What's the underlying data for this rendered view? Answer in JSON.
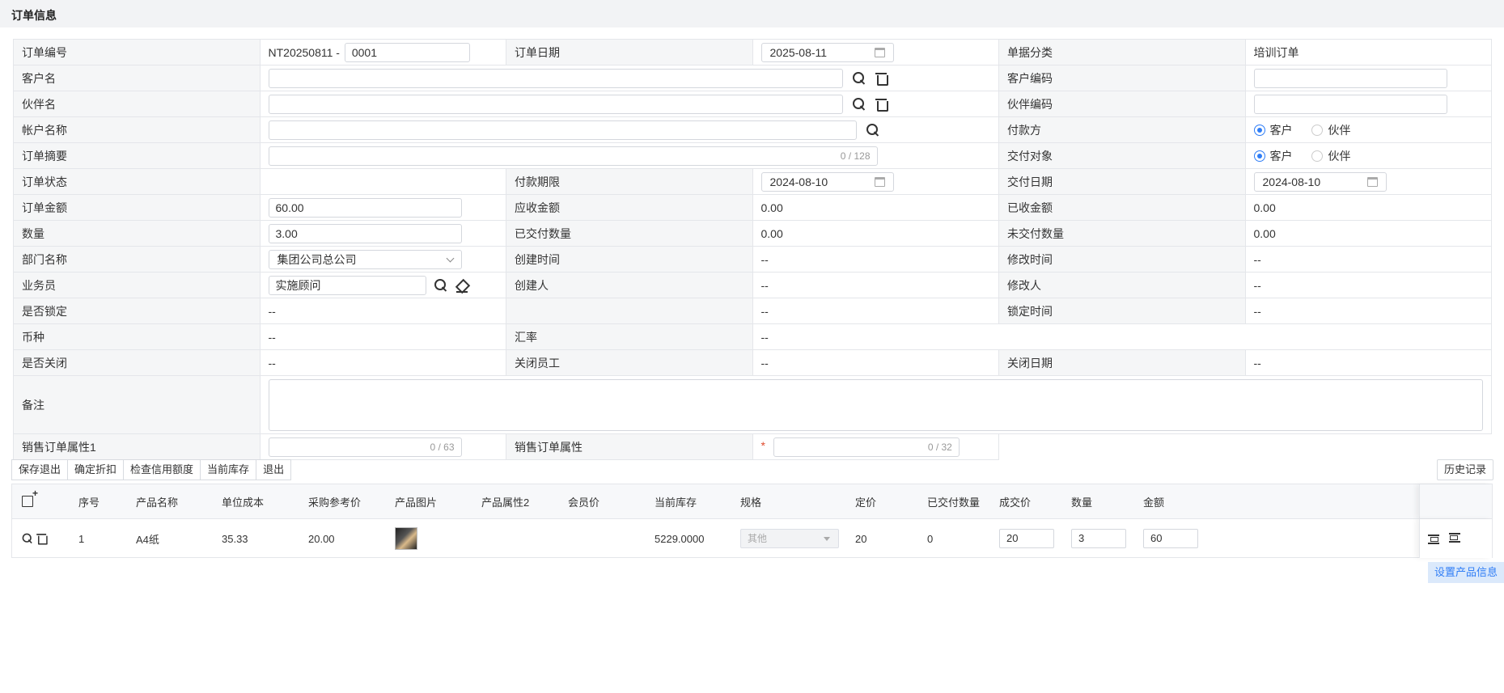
{
  "header": {
    "title": "订单信息"
  },
  "form": {
    "order_no": {
      "label": "订单编号",
      "prefix": "NT20250811 -",
      "value": "0001"
    },
    "order_date": {
      "label": "订单日期",
      "value": "2025-08-11"
    },
    "doc_category": {
      "label": "单据分类",
      "value": "培训订单"
    },
    "customer_name": {
      "label": "客户名",
      "value": ""
    },
    "customer_code": {
      "label": "客户编码",
      "value": ""
    },
    "partner_name": {
      "label": "伙伴名",
      "value": ""
    },
    "partner_code": {
      "label": "伙伴编码",
      "value": ""
    },
    "account_name": {
      "label": "帐户名称",
      "value": ""
    },
    "payer": {
      "label": "付款方",
      "options": [
        "客户",
        "伙伴"
      ],
      "selected": "客户"
    },
    "summary": {
      "label": "订单摘要",
      "value": "",
      "counter": "0 / 128"
    },
    "delivery_target": {
      "label": "交付对象",
      "options": [
        "客户",
        "伙伴"
      ],
      "selected": "客户"
    },
    "order_status": {
      "label": "订单状态",
      "value": ""
    },
    "payment_deadline": {
      "label": "付款期限",
      "value": "2024-08-10"
    },
    "delivery_date": {
      "label": "交付日期",
      "value": "2024-08-10"
    },
    "order_amount": {
      "label": "订单金额",
      "value": "60.00"
    },
    "receivable": {
      "label": "应收金额",
      "value": "0.00"
    },
    "received": {
      "label": "已收金额",
      "value": "0.00"
    },
    "quantity": {
      "label": "数量",
      "value": "3.00"
    },
    "delivered_qty": {
      "label": "已交付数量",
      "value": "0.00"
    },
    "undelivered_qty": {
      "label": "未交付数量",
      "value": "0.00"
    },
    "department": {
      "label": "部门名称",
      "value": "集团公司总公司"
    },
    "created_time": {
      "label": "创建时间",
      "value": "--"
    },
    "modified_time": {
      "label": "修改时间",
      "value": "--"
    },
    "salesperson": {
      "label": "业务员",
      "value": "实施顾问"
    },
    "creator": {
      "label": "创建人",
      "value": "--"
    },
    "modifier": {
      "label": "修改人",
      "value": "--"
    },
    "is_locked": {
      "label": "是否锁定",
      "value": "--"
    },
    "locker": {
      "label": "",
      "value": "--"
    },
    "lock_time": {
      "label": "锁定时间",
      "value": "--"
    },
    "currency": {
      "label": "币种",
      "value": "--"
    },
    "exchange_rate": {
      "label": "汇率",
      "value": "--"
    },
    "is_closed": {
      "label": "是否关闭",
      "value": "--"
    },
    "close_employee": {
      "label": "关闭员工",
      "value": "--"
    },
    "close_date": {
      "label": "关闭日期",
      "value": "--"
    },
    "remark": {
      "label": "备注",
      "value": ""
    },
    "attr1": {
      "label": "销售订单属性1",
      "value": "",
      "counter": "0 / 63"
    },
    "attr": {
      "label": "销售订单属性",
      "required_mark": "*",
      "value": "",
      "counter": "0 / 32"
    }
  },
  "toolbar": {
    "buttons": [
      "保存退出",
      "确定折扣",
      "检查信用额度",
      "当前库存",
      "退出"
    ],
    "history": "历史记录"
  },
  "grid": {
    "columns": [
      "序号",
      "产品名称",
      "单位成本",
      "采购参考价",
      "产品图片",
      "产品属性2",
      "会员价",
      "当前库存",
      "规格",
      "定价",
      "已交付数量",
      "成交价",
      "数量",
      "金额"
    ],
    "rows": [
      {
        "seq": "1",
        "product_name": "A4纸",
        "unit_cost": "35.33",
        "purchase_ref_price": "20.00",
        "product_attr2": "",
        "member_price": "",
        "current_stock": "5229.0000",
        "spec": "其他",
        "list_price": "20",
        "delivered_qty": "0",
        "deal_price": "20",
        "qty": "3",
        "amount": "60"
      }
    ]
  },
  "footer": {
    "set_product_info": "设置产品信息"
  },
  "colors": {
    "accent": "#2f7df6",
    "label_bg": "#f5f6f7",
    "border": "#e4e6ea",
    "required": "#e04b2e"
  }
}
